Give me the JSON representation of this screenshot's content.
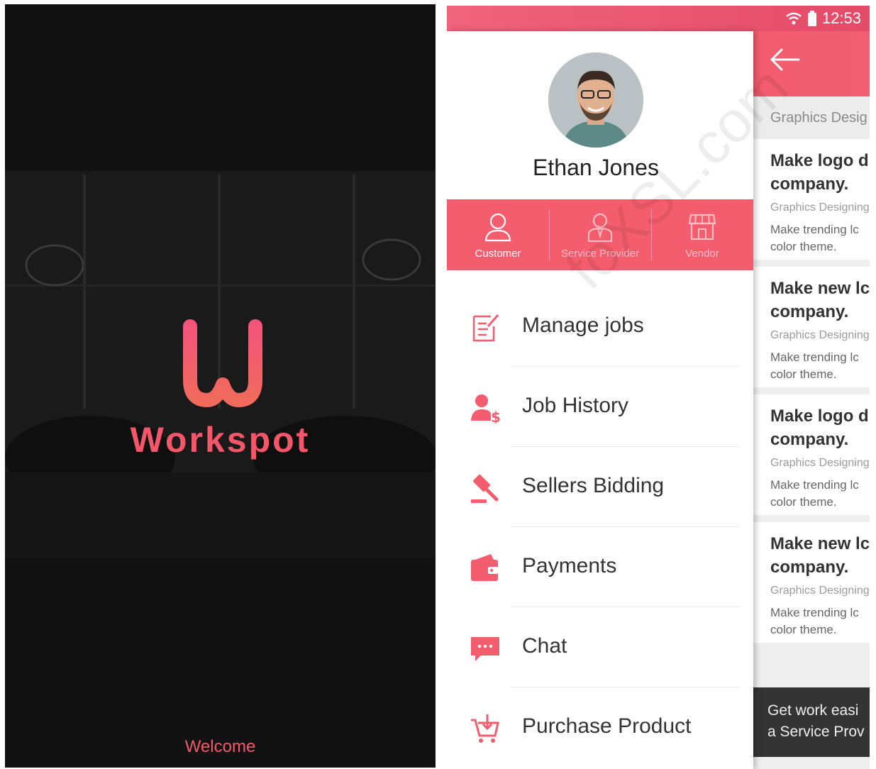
{
  "splash": {
    "brand": "Workspot",
    "welcome": "Welcome",
    "logo_color": "#f4566a"
  },
  "status_bar": {
    "time": "12:53",
    "icons": [
      "wifi-icon",
      "battery-icon"
    ]
  },
  "drawer": {
    "user_name": "Ethan Jones",
    "roles": [
      {
        "label": "Customer",
        "icon": "user-icon",
        "active": true
      },
      {
        "label": "Service Provider",
        "icon": "service-provider-icon",
        "active": false
      },
      {
        "label": "Vendor",
        "icon": "store-icon",
        "active": false
      }
    ],
    "menu": [
      {
        "label": "Manage jobs",
        "icon": "edit-document-icon"
      },
      {
        "label": "Job History",
        "icon": "user-dollar-icon"
      },
      {
        "label": "Sellers Bidding",
        "icon": "gavel-icon"
      },
      {
        "label": "Payments",
        "icon": "wallet-icon"
      },
      {
        "label": "Chat",
        "icon": "chat-bubble-icon"
      },
      {
        "label": "Purchase Product",
        "icon": "cart-icon"
      }
    ]
  },
  "content": {
    "category": "Graphics Desig",
    "cards": [
      {
        "title_1": "Make logo d",
        "title_2": "company.",
        "category": "Graphics Designing",
        "desc_1": "Make trending lc",
        "desc_2": "color theme."
      },
      {
        "title_1": "Make new lc",
        "title_2": "company.",
        "category": "Graphics Designing",
        "desc_1": "Make trending lc",
        "desc_2": "color theme."
      },
      {
        "title_1": "Make logo d",
        "title_2": "company.",
        "category": "Graphics Designing",
        "desc_1": "Make trending lc",
        "desc_2": "color theme."
      },
      {
        "title_1": "Make new lc",
        "title_2": "company.",
        "category": "Graphics Designing",
        "desc_1": "Make trending lc",
        "desc_2": "color theme."
      }
    ],
    "toast_1": "Get work easi",
    "toast_2": "a Service Prov"
  },
  "watermark": "foXSL.com",
  "colors": {
    "accent": "#f35d6d",
    "accent_dark": "#e44b69",
    "splash_bg": "#141414"
  }
}
